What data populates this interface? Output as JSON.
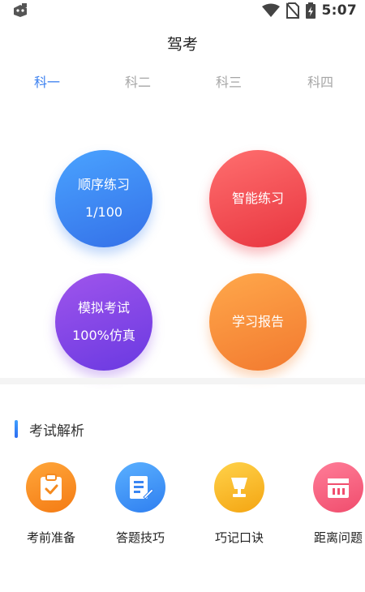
{
  "status_bar": {
    "time": "5:07",
    "left_icon": "notification-app-icon",
    "right_icons": [
      "wifi-icon",
      "no-sim-icon",
      "battery-icon"
    ]
  },
  "header": {
    "title": "驾考"
  },
  "tabs": [
    {
      "label": "科一",
      "active": true
    },
    {
      "label": "科二",
      "active": false
    },
    {
      "label": "科三",
      "active": false
    },
    {
      "label": "科四",
      "active": false
    }
  ],
  "practice": {
    "sequential": {
      "label": "顺序练习",
      "progress": "1/100"
    },
    "smart": {
      "label": "智能练习"
    },
    "mock": {
      "label": "模拟考试",
      "subtitle": "100%仿真"
    },
    "report": {
      "label": "学习报告"
    }
  },
  "analysis": {
    "title": "考试解析",
    "items": [
      {
        "label": "考前准备",
        "icon": "clipboard-icon"
      },
      {
        "label": "答题技巧",
        "icon": "notepad-pen-icon"
      },
      {
        "label": "巧记口诀",
        "icon": "lamp-icon"
      },
      {
        "label": "距离问题",
        "icon": "calendar-icon"
      }
    ]
  },
  "colors": {
    "accent": "#3a7ff0",
    "tab_inactive": "#a6a6a6",
    "blue": "#3470e8",
    "red": "#e8353f",
    "purple": "#6a39e1",
    "orange": "#f2792f"
  }
}
